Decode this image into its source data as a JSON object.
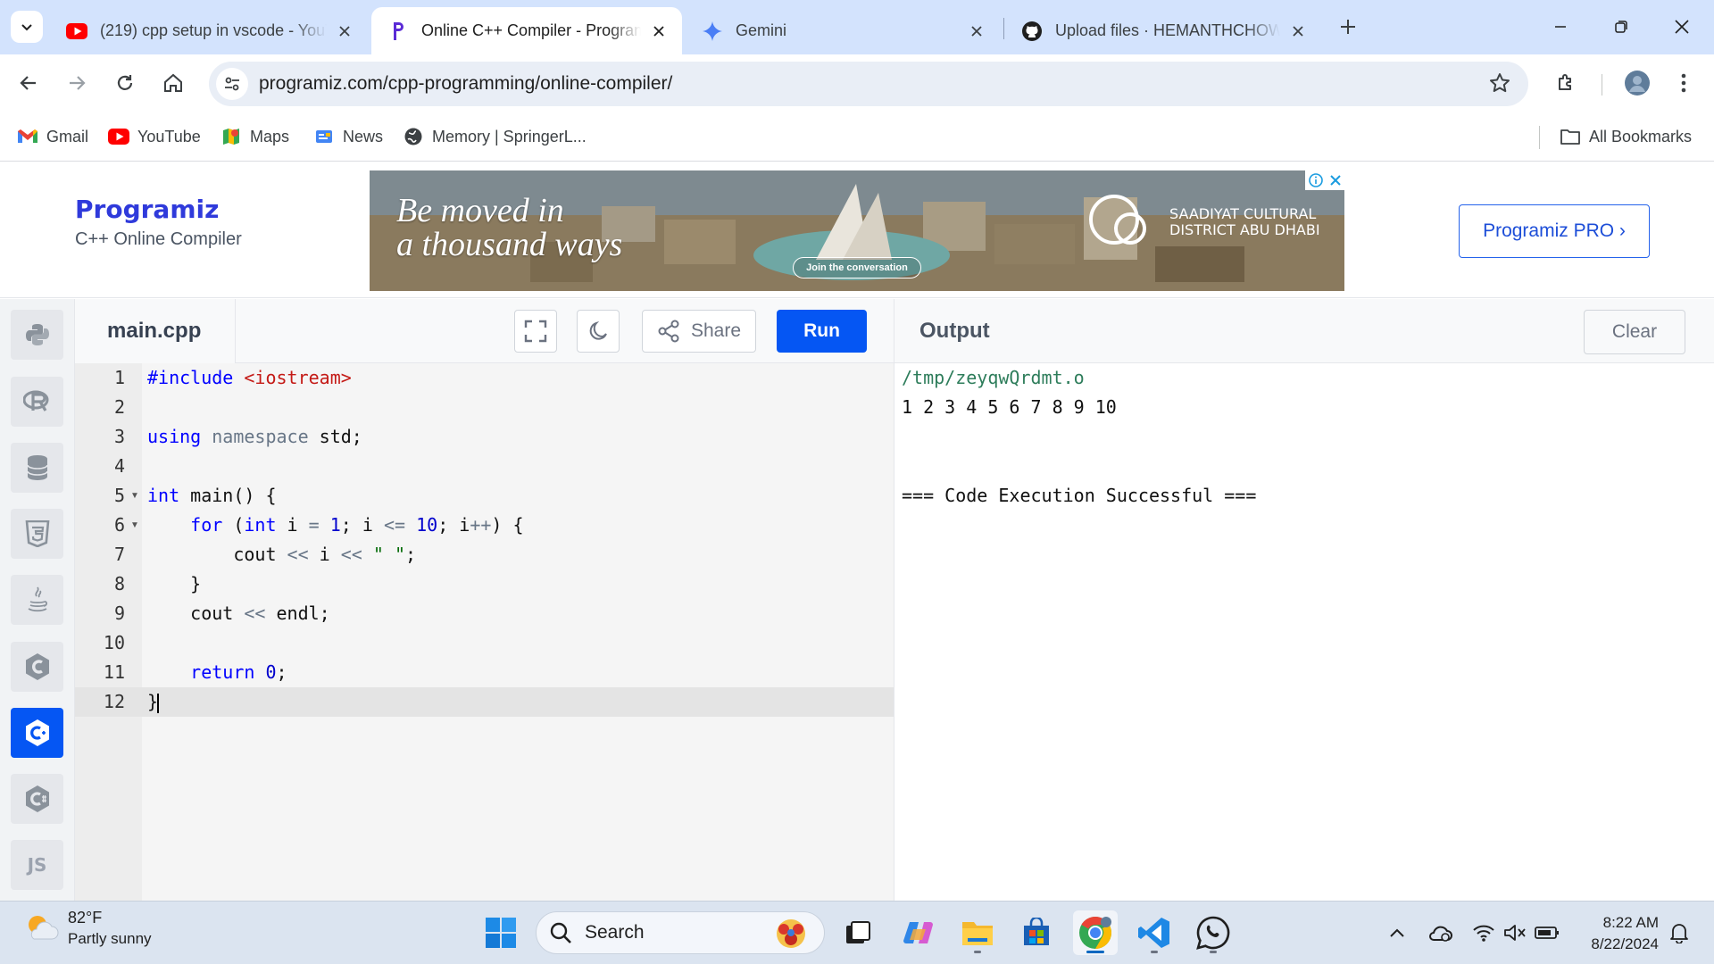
{
  "browser": {
    "tabs": [
      {
        "title": "(219) cpp setup in vscode - YouTube",
        "icon": "youtube-icon"
      },
      {
        "title": "Online C++ Compiler - Programiz",
        "icon": "programiz-icon",
        "active": true
      },
      {
        "title": "Gemini",
        "icon": "gemini-icon"
      },
      {
        "title": "Upload files · HEMANTHCHOWDARY",
        "icon": "github-icon"
      }
    ],
    "url": "programiz.com/cpp-programming/online-compiler/",
    "bookmarks": [
      {
        "label": "Gmail",
        "icon": "gmail-icon"
      },
      {
        "label": "YouTube",
        "icon": "youtube-icon"
      },
      {
        "label": "Maps",
        "icon": "maps-icon"
      },
      {
        "label": "News",
        "icon": "news-icon"
      },
      {
        "label": "Memory | SpringerL...",
        "icon": "globe-icon"
      }
    ],
    "all_bookmarks": "All Bookmarks"
  },
  "site": {
    "logo": "Programiz",
    "subtitle": "C++ Online Compiler",
    "pro_button": "Programiz PRO ›",
    "ad": {
      "headline_1": "Be moved in",
      "headline_2": "a thousand ways",
      "brand_1": "SAADIYAT CULTURAL",
      "brand_2": "DISTRICT ABU DHABI",
      "cta": "Join the conversation"
    }
  },
  "editor": {
    "file_name": "main.cpp",
    "share_label": "Share",
    "run_label": "Run",
    "line_numbers": [
      "1",
      "2",
      "3",
      "4",
      "5",
      "6",
      "7",
      "8",
      "9",
      "10",
      "11",
      "12"
    ],
    "lines": [
      "#include <iostream>",
      "",
      "using namespace std;",
      "",
      "int main() {",
      "    for (int i = 1; i <= 10; i++) {",
      "        cout << i << \" \";",
      "    }",
      "    cout << endl;",
      "",
      "    return 0;",
      "}"
    ]
  },
  "output": {
    "title": "Output",
    "clear_label": "Clear",
    "lines": [
      "/tmp/zeyqwQrdmt.o",
      "1 2 3 4 5 6 7 8 9 10",
      "",
      "",
      "=== Code Execution Successful ==="
    ]
  },
  "taskbar": {
    "temperature": "82°F",
    "condition": "Partly sunny",
    "search_placeholder": "Search",
    "time": "8:22 AM",
    "date": "8/22/2024"
  },
  "colors": {
    "run_blue": "#0556f3",
    "tabstrip": "#d3e3fd",
    "programiz_logo": "#2f3adb"
  }
}
